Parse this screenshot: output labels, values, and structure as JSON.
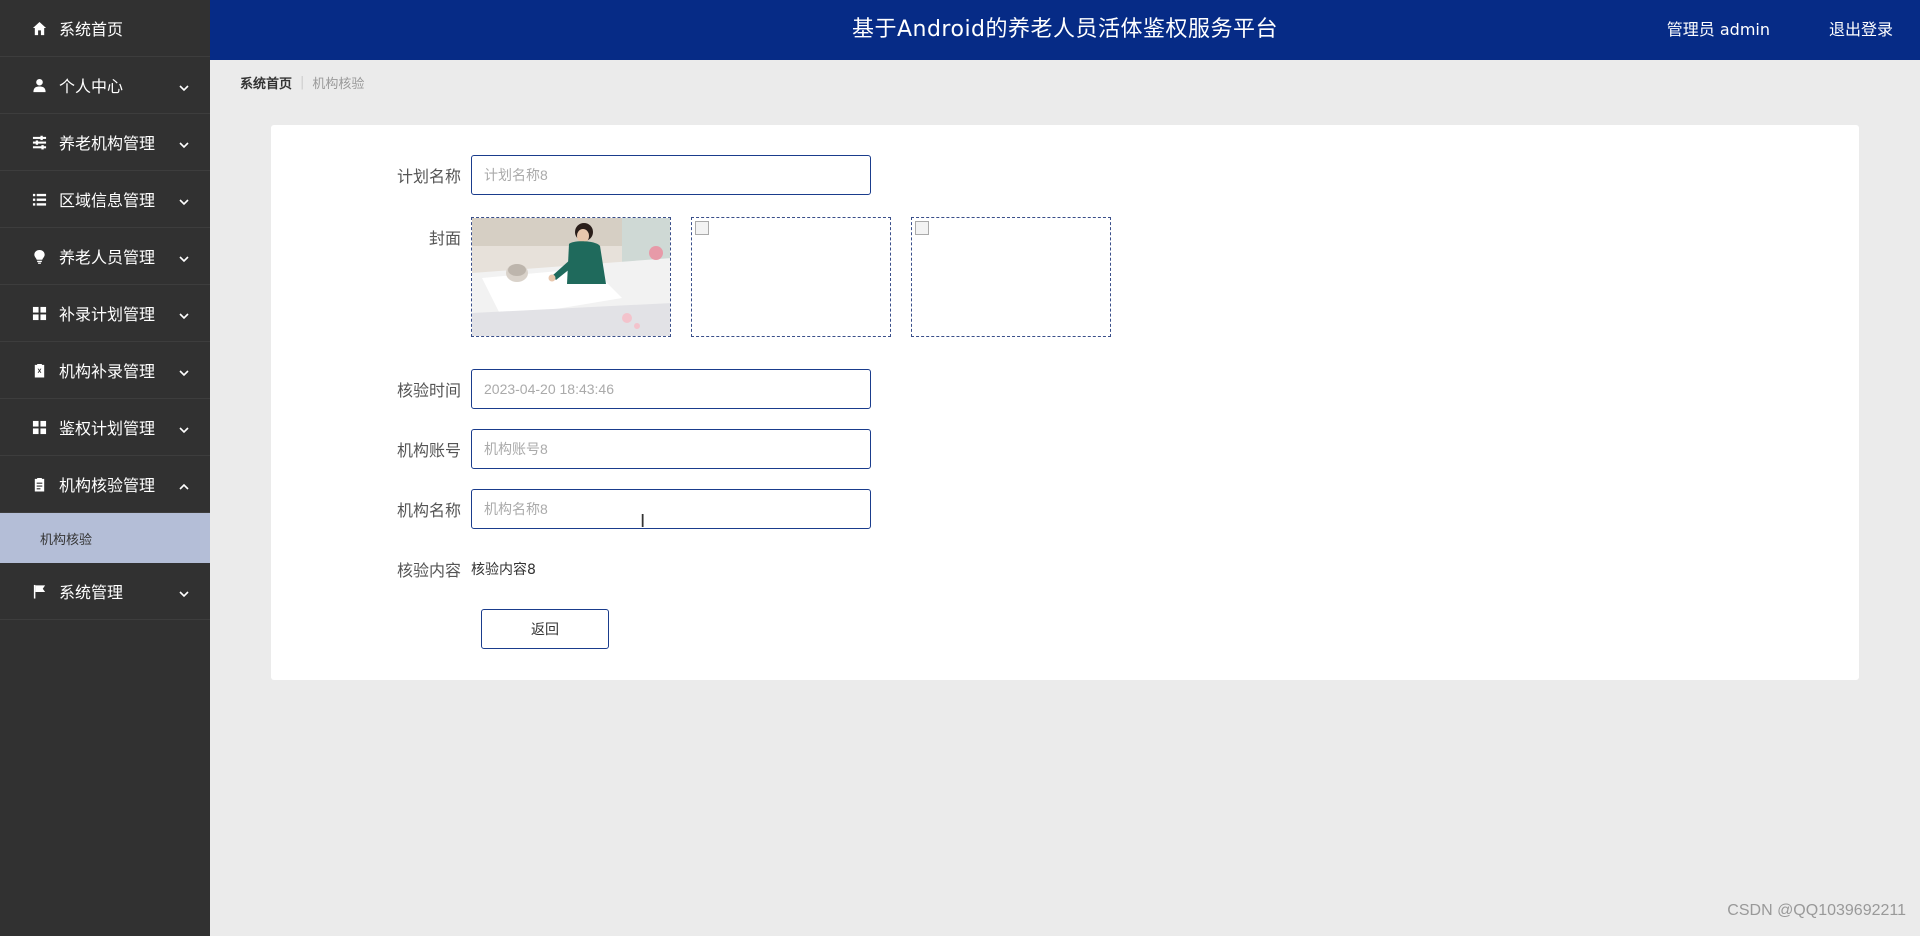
{
  "app": {
    "title": "基于Android的养老人员活体鉴权服务平台",
    "user_label": "管理员 admin",
    "logout_label": "退出登录"
  },
  "sidebar": {
    "items": [
      {
        "label": "系统首页",
        "icon": "home-icon"
      },
      {
        "label": "个人中心",
        "icon": "user-icon"
      },
      {
        "label": "养老机构管理",
        "icon": "sliders-icon"
      },
      {
        "label": "区域信息管理",
        "icon": "list-icon"
      },
      {
        "label": "养老人员管理",
        "icon": "lightbulb-icon"
      },
      {
        "label": "补录计划管理",
        "icon": "grid-icon"
      },
      {
        "label": "机构补录管理",
        "icon": "clipboard-x-icon"
      },
      {
        "label": "鉴权计划管理",
        "icon": "grid-icon"
      },
      {
        "label": "机构核验管理",
        "icon": "clipboard-icon"
      },
      {
        "label": "系统管理",
        "icon": "flag-icon"
      }
    ],
    "sub_item": "机构核验"
  },
  "breadcrumb": {
    "home": "系统首页",
    "separator": "|",
    "current": "机构核验"
  },
  "form": {
    "plan_name_label": "计划名称",
    "plan_name_placeholder": "计划名称8",
    "cover_label": "封面",
    "check_time_label": "核验时间",
    "check_time_placeholder": "2023-04-20 18:43:46",
    "org_account_label": "机构账号",
    "org_account_placeholder": "机构账号8",
    "org_name_label": "机构名称",
    "org_name_placeholder": "机构名称8",
    "content_label": "核验内容",
    "content_value": "核验内容8",
    "back_button": "返回"
  },
  "watermark": "CSDN @QQ1039692211"
}
